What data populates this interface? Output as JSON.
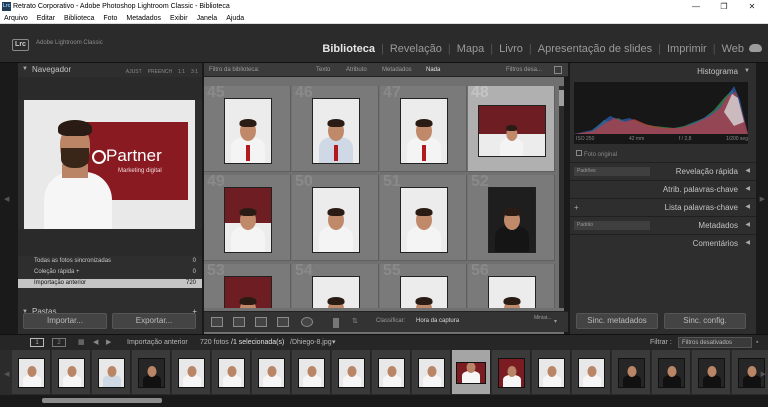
{
  "window": {
    "title": "Retrato Corporativo - Adobe Photoshop Lightroom Classic - Biblioteca",
    "app_icon": "Lrc",
    "controls": {
      "minimize": "—",
      "maximize": "❐",
      "close": "✕"
    }
  },
  "menu": [
    "Arquivo",
    "Editar",
    "Biblioteca",
    "Foto",
    "Metadados",
    "Exibir",
    "Janela",
    "Ajuda"
  ],
  "header": {
    "logo": "Lrc",
    "brand": "Adobe Lightroom Classic",
    "modules": [
      "Biblioteca",
      "Revelação",
      "Mapa",
      "Livro",
      "Apresentação de slides",
      "Imprimir",
      "Web"
    ],
    "active_module": "Biblioteca",
    "separator": "|"
  },
  "left": {
    "navigator": {
      "title": "Navegador",
      "options": [
        "AJUST",
        "PREENCH",
        "1:1",
        "3:1"
      ]
    },
    "preview_logo": {
      "brand": "Partner",
      "tagline": "Marketing digital"
    },
    "catalog": [
      {
        "label": "Todas as fotos sincronizadas",
        "count": "0"
      },
      {
        "label": "Coleção rápida +",
        "count": "0"
      },
      {
        "label": "Importação anterior",
        "count": "720"
      }
    ],
    "folders": {
      "title": "Pastas",
      "add": "+"
    },
    "import_label": "Importar...",
    "export_label": "Exportar..."
  },
  "filter_bar": {
    "label": "Filtro da biblioteca:",
    "options": [
      "Texto",
      "Atributo",
      "Metadados",
      "Nada"
    ],
    "active": "Nada",
    "presets": "Filtros desa..."
  },
  "grid": {
    "cell_numbers": [
      "45",
      "46",
      "47",
      "48",
      "49",
      "50",
      "51",
      "52",
      "53",
      "54",
      "55",
      "56"
    ],
    "selected_index": 3
  },
  "grid_toolbar": {
    "sort_label": "Classificar:",
    "sort_value": "Hora da captura",
    "thumb_label": "Miniat..."
  },
  "right": {
    "histogram": {
      "title": "Histograma",
      "iso": "ISO 250",
      "focal": "42 mm",
      "aperture": "f / 2,8",
      "shutter": "1/200 seg",
      "original": "Foto original"
    },
    "quick_develop": {
      "title": "Revelação rápida",
      "preset": "Padrões"
    },
    "keywording": {
      "title": "Atrib. palavras-chave"
    },
    "keyword_list": {
      "title": "Lista palavras-chave",
      "add": "+"
    },
    "metadata": {
      "title": "Metadados",
      "preset": "Padrão"
    },
    "comments": {
      "title": "Comentários"
    },
    "sync_meta": "Sinc. metadados",
    "sync_settings": "Sinc. config."
  },
  "filmstrip": {
    "pages": [
      "1",
      "2"
    ],
    "source": "Importação anterior",
    "count": "720 fotos",
    "selected": "/1 selecionada(s)",
    "filename": "/Dhiego-8.jpg",
    "filter_label": "Filtrar :",
    "filter_value": "Filtros desativados",
    "selected_thumb": 11
  }
}
